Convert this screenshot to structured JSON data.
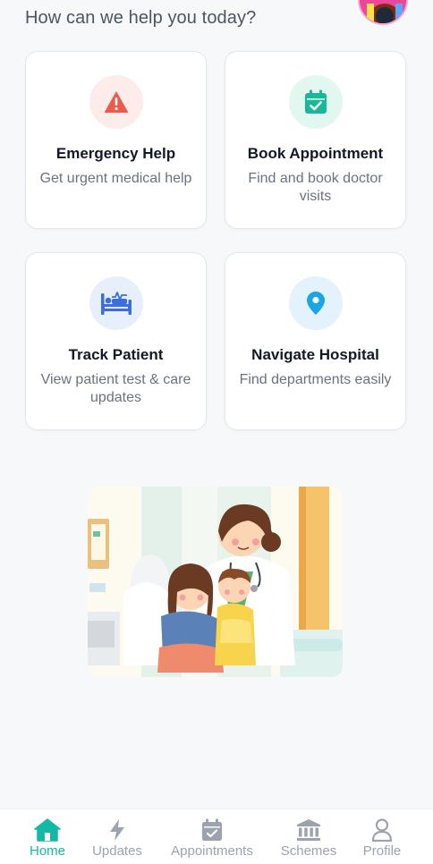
{
  "header": {
    "greeting": "How can we help you today?"
  },
  "cards": [
    {
      "title": "Emergency Help",
      "description": "Get urgent medical help",
      "icon": "warning-icon",
      "icon_color": "#ef5b4b",
      "icon_bg": "#fdecea"
    },
    {
      "title": "Book Appointment",
      "description": "Find and book doctor visits",
      "icon": "calendar-check-icon",
      "icon_color": "#16b998",
      "icon_bg": "#e3f7f1"
    },
    {
      "title": "Track Patient",
      "description": "View patient test & care updates",
      "icon": "hospital-bed-icon",
      "icon_color": "#3b6fe0",
      "icon_bg": "#e7eefc"
    },
    {
      "title": "Navigate Hospital",
      "description": "Find departments easily",
      "icon": "location-pin-icon",
      "icon_color": "#1aa6e6",
      "icon_bg": "#e3f2fc"
    }
  ],
  "nav": {
    "items": [
      {
        "label": "Home",
        "icon": "home-icon",
        "active": true
      },
      {
        "label": "Updates",
        "icon": "lightning-icon",
        "active": false
      },
      {
        "label": "Appointments",
        "icon": "calendar-icon",
        "active": false
      },
      {
        "label": "Schemes",
        "icon": "bank-icon",
        "active": false
      },
      {
        "label": "Profile",
        "icon": "user-icon",
        "active": false
      }
    ],
    "active_color": "#14b8a6",
    "inactive_color": "#9ca3af"
  }
}
